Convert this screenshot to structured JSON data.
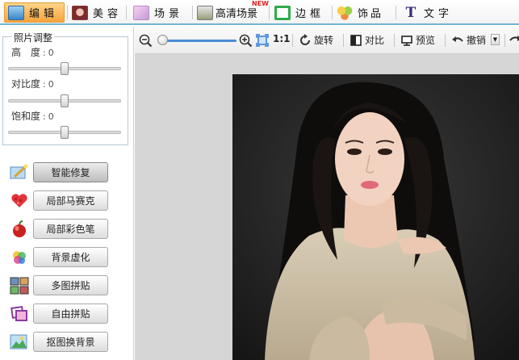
{
  "top_menu": {
    "items": [
      {
        "label": "编辑"
      },
      {
        "label": "美容"
      },
      {
        "label": "场景"
      },
      {
        "label": "高清场景",
        "badge": "NEW"
      },
      {
        "label": "边框"
      },
      {
        "label": "饰品"
      },
      {
        "label": "文字"
      }
    ]
  },
  "adjust": {
    "title": "照片调整",
    "brightness": {
      "label": "高　度",
      "value": "0",
      "level": 0.5
    },
    "contrast": {
      "label": "对比度",
      "value": "0",
      "level": 0.5
    },
    "saturation": {
      "label": "饱和度",
      "value": "0",
      "level": 0.5
    }
  },
  "tools": [
    {
      "label": "智能修复",
      "icon": "magic-wand-icon"
    },
    {
      "label": "局部马赛克",
      "icon": "mosaic-heart-icon"
    },
    {
      "label": "局部彩色笔",
      "icon": "apple-color-icon"
    },
    {
      "label": "背景虚化",
      "icon": "blur-dots-icon"
    },
    {
      "label": "多图拼贴",
      "icon": "grid-collage-icon"
    },
    {
      "label": "自由拼贴",
      "icon": "free-collage-icon"
    },
    {
      "label": "抠图换背景",
      "icon": "cutout-icon"
    }
  ],
  "toolbar": {
    "zoom_fit": "1:1",
    "rotate": "旋转",
    "compare": "对比",
    "preview": "预览",
    "undo": "撤销"
  },
  "colors": {
    "accent_orange": "#f5a43c",
    "accent_blue": "#4b8bd4",
    "workspace_gray": "#d6d6d6"
  }
}
